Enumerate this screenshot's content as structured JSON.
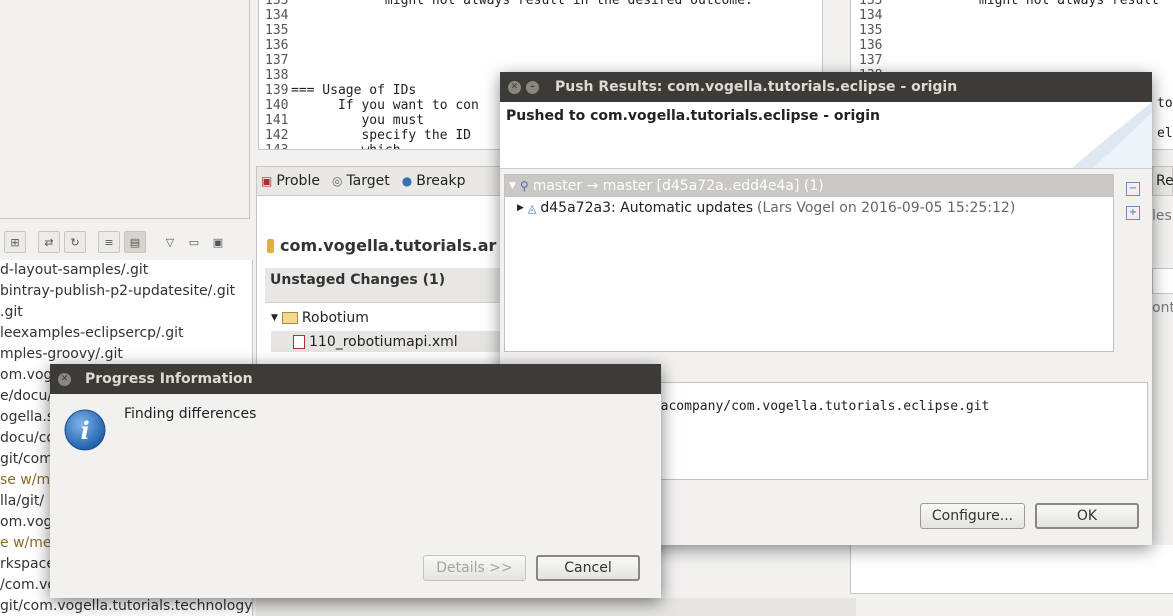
{
  "left_panel": {
    "repos": [
      {
        "text": "d-layout-samples/.git",
        "style": "normal"
      },
      {
        "text": "bintray-publish-p2-updatesite/.git",
        "style": "normal"
      },
      {
        "text": ".git",
        "style": "normal"
      },
      {
        "text": "leexamples-eclipsercp/.git",
        "style": "normal"
      },
      {
        "text": "mples-groovy/.git",
        "style": "normal"
      },
      {
        "text": "om.voge",
        "style": "normal"
      },
      {
        "text": "e/docu/",
        "style": "normal"
      },
      {
        "text": "ogella.sa",
        "style": "normal"
      },
      {
        "text": "docu/co",
        "style": "normal"
      },
      {
        "text": "git/com",
        "style": "normal"
      },
      {
        "text": "se w/m",
        "style": "brown"
      },
      {
        "text": "lla/git/",
        "style": "normal"
      },
      {
        "text": "om.vog",
        "style": "normal"
      },
      {
        "text": "e w/mer",
        "style": "brown"
      },
      {
        "text": "rkspace",
        "style": "normal"
      },
      {
        "text": "/com.vo",
        "style": "normal"
      },
      {
        "text": "git/com.vogella.tutorials.technology",
        "style": "normal"
      }
    ]
  },
  "editor_left": {
    "lines": [
      {
        "n": "133",
        "code": "            might not always result in the desired outcome."
      },
      {
        "n": "134",
        "code": ""
      },
      {
        "n": "135",
        "code": ""
      },
      {
        "n": "136",
        "code": ""
      },
      {
        "n": "137",
        "code": ""
      },
      {
        "n": "138",
        "code": ""
      },
      {
        "n": "139",
        "code": "=== Usage of IDs"
      },
      {
        "n": "140",
        "code": "      If you want to con"
      },
      {
        "n": "141",
        "code": "         you must"
      },
      {
        "n": "142",
        "code": "         specify the ID"
      },
      {
        "n": "143",
        "code": "         which"
      }
    ]
  },
  "editor_right": {
    "lines": [
      {
        "n": "133",
        "code": "            might not always result"
      },
      {
        "n": "134",
        "code": ""
      },
      {
        "n": "135",
        "code": ""
      },
      {
        "n": "136",
        "code": ""
      },
      {
        "n": "137",
        "code": ""
      },
      {
        "n": "138",
        "code": ""
      }
    ],
    "partial_right_1": "to",
    "partial_right_2": "el"
  },
  "views": {
    "tabs": [
      "Proble",
      "Target",
      "Breakp"
    ],
    "right_tab": "Re",
    "right_frag_1": "les",
    "right_frag_2": "ont"
  },
  "staging": {
    "repo_title": "com.vogella.tutorials.ar",
    "unstaged_header": "Unstaged Changes (1)",
    "folder": "Robotium",
    "file": "110_robotiumapi.xml"
  },
  "push_dialog": {
    "title": "Push Results: com.vogella.tutorials.eclipse - origin",
    "header": "Pushed to com.vogella.tutorials.eclipse - origin",
    "tree_ref": "master → master [d45a72a..edd4e4a] (1)",
    "commit_main": "d45a72a3: Automatic updates",
    "commit_meta": "(Lars Vogel on 2016-09-05 15:25:12)",
    "uri_fragment": "llacompany/com.vogella.tutorials.eclipse.git",
    "configure_label": "Configure...",
    "ok_label": "OK"
  },
  "progress_dialog": {
    "title": "Progress Information",
    "message": "Finding differences",
    "details_label": "Details >>",
    "cancel_label": "Cancel"
  },
  "colors": {
    "titlebar": "#3c3b37",
    "selection": "#e6e5e3",
    "info_blue": "#3a7fc8"
  }
}
